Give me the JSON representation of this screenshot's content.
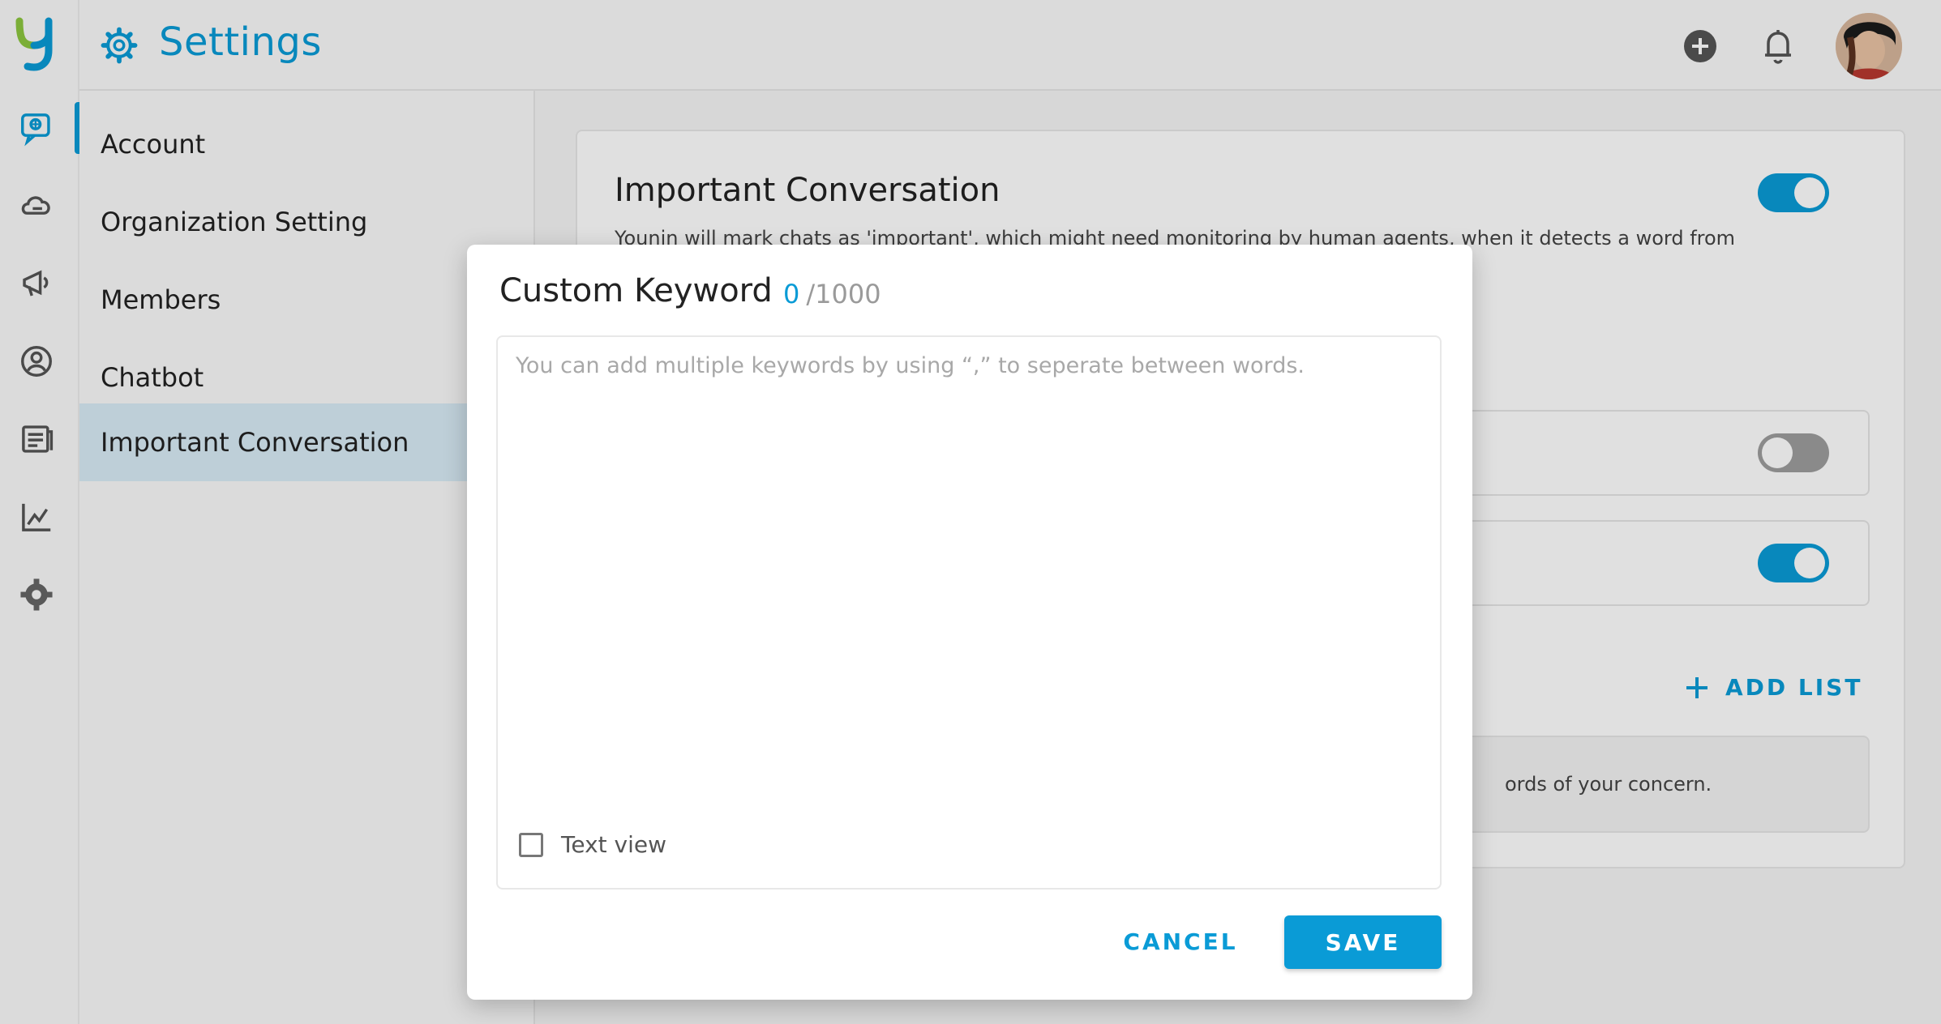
{
  "header": {
    "title": "Settings"
  },
  "sidebar_nav": {
    "icons": [
      "chat-icon",
      "cloud-chat-icon",
      "megaphone-icon",
      "contacts-icon",
      "report-icon",
      "analytics-icon",
      "settings-icon"
    ]
  },
  "settings_menu": {
    "items": [
      {
        "label": "Account"
      },
      {
        "label": "Organization Setting"
      },
      {
        "label": "Members"
      },
      {
        "label": "Chatbot"
      },
      {
        "label": "Important Conversation"
      }
    ],
    "active": "Important Conversation"
  },
  "content": {
    "title": "Important Conversation",
    "description": "Younin will mark chats as 'important', which might need monitoring by human agents, when it detects a word from",
    "main_toggle": "on",
    "list_toggles": [
      "off",
      "on"
    ],
    "add_list_label": "ADD LIST",
    "hint_text": "ords of your concern."
  },
  "modal": {
    "title": "Custom Keyword",
    "count_current": "0",
    "count_max": "/1000",
    "placeholder": "You can add multiple keywords by using “,” to seperate between words.",
    "value": "",
    "text_view_label": "Text view",
    "text_view_checked": false,
    "cancel_label": "CANCEL",
    "save_label": "SAVE"
  },
  "colors": {
    "accent": "#0a9bd6",
    "active_menu_bg": "#d9ecf6"
  }
}
